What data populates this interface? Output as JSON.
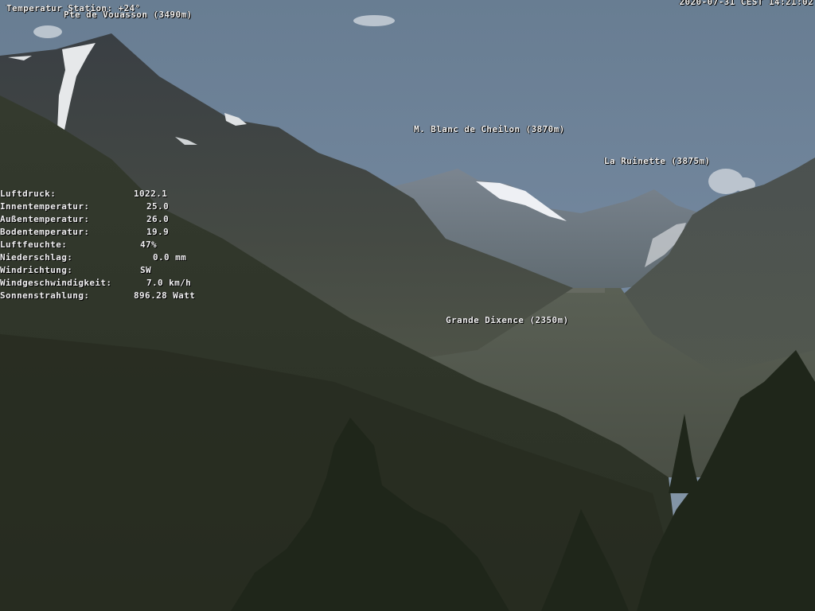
{
  "header": {
    "station": "Temperatur Station: +24°",
    "timestamp": "2020-07-31 CEST 14:21:02"
  },
  "peaks": {
    "vouasson": "Pte de Vouasson (3490m)",
    "cheilon": "M. Blanc de Cheilon (3870m)",
    "ruinette": "La Ruinette (3875m)",
    "dixence": "Grande Dixence (2350m)"
  },
  "weather": [
    {
      "label": "Luftdruck:",
      "value": "1022.1"
    },
    {
      "label": "Innentemperatur:",
      "value": "25.0"
    },
    {
      "label": "Außentemperatur:",
      "value": "26.0"
    },
    {
      "label": "Bodentemperatur:",
      "value": "19.9"
    },
    {
      "label": "Luftfeuchte:",
      "value": "47%"
    },
    {
      "label": "Niederschlag:",
      "value": "0.0 mm"
    },
    {
      "label": "Windrichtung:",
      "value": "SW"
    },
    {
      "label": "Windgeschwindigkeit:",
      "value": "7.0 km/h"
    },
    {
      "label": "Sonnenstrahlung:",
      "value": "896.28 Watt"
    }
  ],
  "colors": {
    "sky": "#6f8498",
    "snow": "#eef0f4",
    "forest": "#2c3322",
    "text": "#f2f2f2"
  }
}
